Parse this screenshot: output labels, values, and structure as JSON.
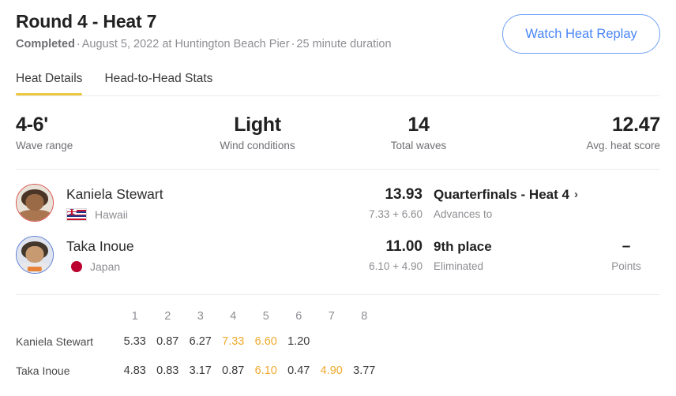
{
  "header": {
    "title": "Round 4 - Heat 7",
    "status": "Completed",
    "meta": "August 5, 2022 at Huntington Beach Pier",
    "duration": "25 minute duration",
    "separator": "·",
    "replay_button": "Watch Heat Replay"
  },
  "tabs": [
    {
      "label": "Heat Details",
      "active": true
    },
    {
      "label": "Head-to-Head Stats",
      "active": false
    }
  ],
  "stats": [
    {
      "value": "4-6'",
      "label": "Wave range"
    },
    {
      "value": "Light",
      "label": "Wind conditions"
    },
    {
      "value": "14",
      "label": "Total waves"
    },
    {
      "value": "12.47",
      "label": "Avg. heat score"
    }
  ],
  "athletes": [
    {
      "name": "Kaniela Stewart",
      "country": "Hawaii",
      "flag": "hawaii-flag-icon",
      "ring_color": "#d9534f",
      "total": "13.93",
      "breakdown": "7.33 + 6.60",
      "next_heat": "Quarterfinals - Heat 4",
      "next_label": "Advances to",
      "chevron": "›",
      "points": "",
      "points_label": ""
    },
    {
      "name": "Taka Inoue",
      "country": "Japan",
      "flag": "japan-flag-icon",
      "ring_color": "#5b7fd4",
      "total": "11.00",
      "breakdown": "6.10 + 4.90",
      "next_heat": "9th place",
      "next_label": "Eliminated",
      "chevron": "",
      "points": "–",
      "points_label": "Points"
    }
  ],
  "wave_table": {
    "columns": [
      "1",
      "2",
      "3",
      "4",
      "5",
      "6",
      "7",
      "8"
    ],
    "rows": [
      {
        "name": "Kaniela Stewart",
        "scores": [
          "5.33",
          "0.87",
          "6.27",
          "7.33",
          "6.60",
          "1.20",
          "",
          ""
        ],
        "highlighted": [
          false,
          false,
          false,
          true,
          true,
          false,
          false,
          false
        ]
      },
      {
        "name": "Taka Inoue",
        "scores": [
          "4.83",
          "0.83",
          "3.17",
          "0.87",
          "6.10",
          "0.47",
          "4.90",
          "3.77"
        ],
        "highlighted": [
          false,
          false,
          false,
          false,
          true,
          false,
          true,
          false
        ]
      }
    ]
  },
  "colors": {
    "accent_orange": "#f0a92c",
    "tab_underline": "#edc843",
    "link_blue": "#4a86f7",
    "text_primary": "#212121",
    "text_muted": "#8e8e93"
  }
}
